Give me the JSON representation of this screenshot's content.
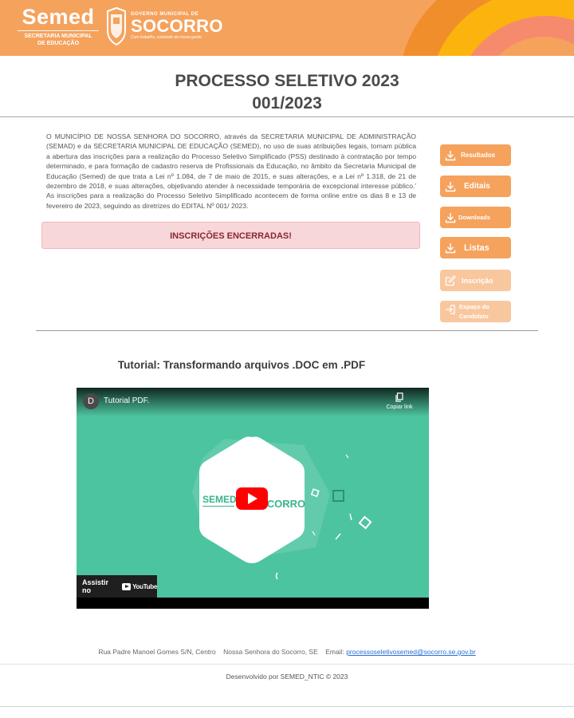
{
  "header": {
    "semed_logo": "Semed",
    "semed_sub1": "SECRETARIA MUNICIPAL",
    "semed_sub2": "DE EDUCAÇÃO",
    "gov_label": "GOVERNO MUNICIPAL DE",
    "city": "SOCORRO",
    "slogan": "Com trabalho, cuidando da nossa gente.",
    "accent": "#f5a25d"
  },
  "title": {
    "line1": "PROCESSO SELETIVO 2023",
    "line2": "001/2023"
  },
  "intro": "O MUNICÍPIO DE NOSSA SENHORA DO SOCORRO, através da SECRETARIA MUNICIPAL DE ADMINISTRAÇÃO (SEMAD) e da SECRETARIA MUNICIPAL DE EDUCAÇÃO (SEMED), no uso de suas atribuições legais, tornam pública a abertura das inscrições para a realização do Processo Seletivo Simplificado (PSS) destinado à contratação por tempo determinado, e para formação de cadastro reserva de Profissionais da Educação, no âmbito da Secretaria Municipal de Educação (Semed) de que trata a Lei nº 1.084, de 7 de maio de 2015, e suas alterações, e a Lei nº 1.318, de 21 de dezembro de 2018, e suas alterações, objetivando atender à necessidade temporária de excepcional interesse público.' As inscrições para a realização do Processo Seletivo Simplificado acontecem de forma online entre os dias 8 e 13 de fevereiro de 2023, seguindo as diretrizes do EDITAL Nº 001/ 2023.",
  "alert": "INSCRIÇÕES ENCERRADAS!",
  "sidebar": {
    "resultados": "Resultados",
    "editais": "Editais",
    "downloads": "Downloads",
    "listas": "Listas",
    "inscricao": "Inscrição",
    "espaco": "Espaço do Candidato"
  },
  "tutorial": {
    "title": "Tutorial: Transformando arquivos .DOC em .PDF",
    "video_avatar": "D",
    "video_title": "Tutorial PDF.",
    "copy_link": "Copiar link",
    "watch_on": "Assistir no",
    "youtube": "YouTube",
    "video_bg": "#4dc4a0"
  },
  "footer": {
    "address": "Rua Padre Manoel Gomes S/N, Centro    Nossa Senhora do Socorro, SE    Email: ",
    "email": "processoseletivosemed@socorro.se.gov.br",
    "developed": "Desenvolvido por SEMED_NTIC © 2023"
  }
}
